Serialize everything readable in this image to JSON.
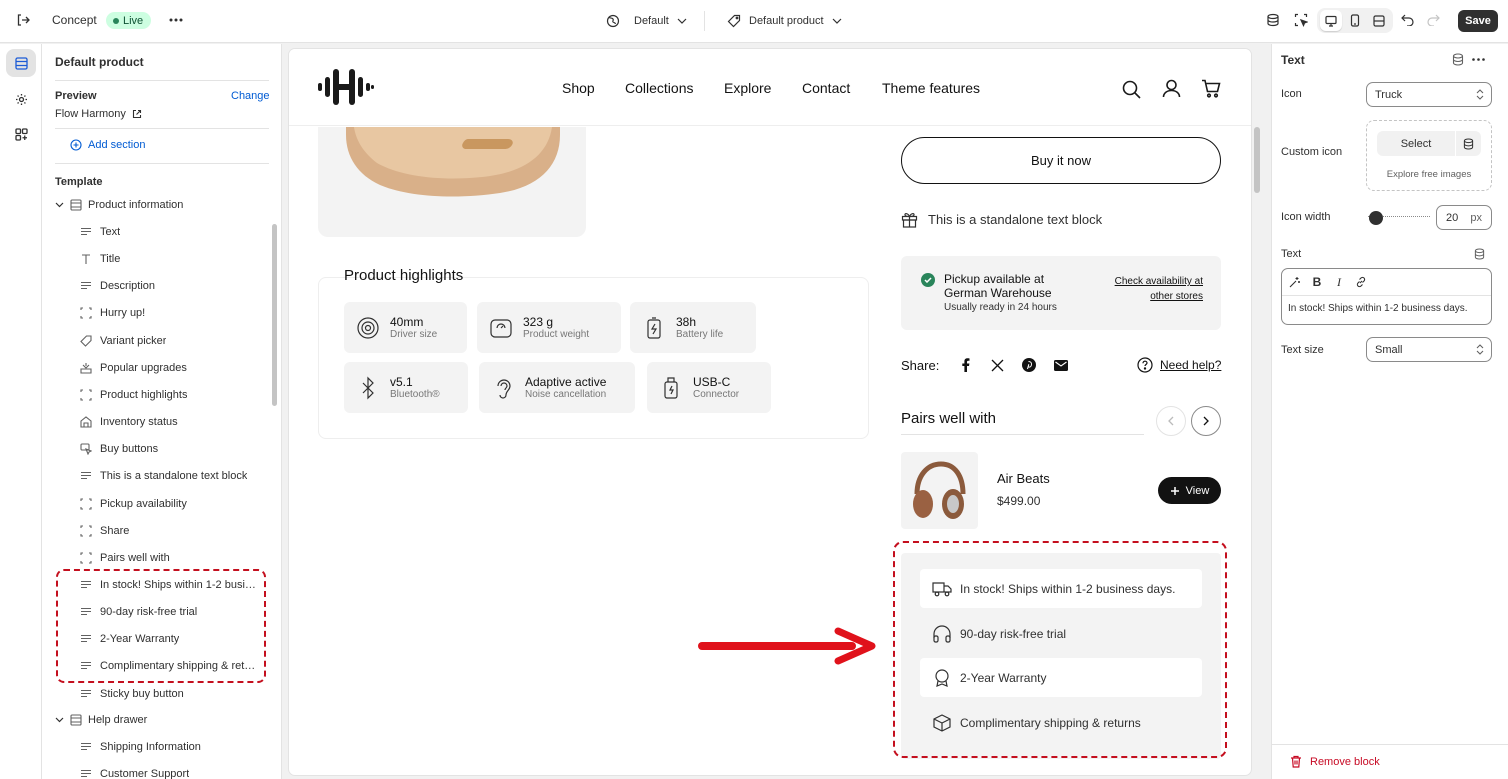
{
  "topbar": {
    "theme_name": "Concept",
    "status": "Live",
    "template_selector": "Default",
    "product_selector": "Default product",
    "save_label": "Save"
  },
  "left_panel": {
    "title": "Default product",
    "preview_label": "Preview",
    "change_label": "Change",
    "preview_product": "Flow Harmony",
    "add_section": "Add section",
    "template_label": "Template",
    "product_information": "Product information",
    "blocks": [
      "Text",
      "Title",
      "Description",
      "Hurry up!",
      "Variant picker",
      "Popular upgrades",
      "Product highlights",
      "Inventory status",
      "Buy buttons",
      "This is a standalone text block",
      "Pickup availability",
      "Share",
      "Pairs well with",
      "In stock! Ships within 1-2 business days.",
      "90-day risk-free trial",
      "2-Year Warranty",
      "Complimentary shipping & returns",
      "Sticky buy button"
    ],
    "help_drawer": "Help drawer",
    "help_items": [
      "Shipping Information",
      "Customer Support"
    ]
  },
  "store": {
    "nav": [
      "Shop",
      "Collections",
      "Explore",
      "Contact",
      "Theme features"
    ],
    "buy_now": "Buy it now",
    "standalone_text": "This is a standalone text block",
    "highlights_title": "Product highlights",
    "highlights": [
      {
        "value": "40mm",
        "label": "Driver size",
        "icon": "speaker-icon"
      },
      {
        "value": "323 g",
        "label": "Product weight",
        "icon": "scale-icon"
      },
      {
        "value": "38h",
        "label": "Battery life",
        "icon": "battery-icon"
      },
      {
        "value": "v5.1",
        "label": "Bluetooth®",
        "icon": "bluetooth-icon"
      },
      {
        "value": "Adaptive active",
        "label": "Noise cancellation",
        "icon": "ear-icon"
      },
      {
        "value": "USB-C",
        "label": "Connector",
        "icon": "usb-icon"
      }
    ],
    "pickup": {
      "title": "Pickup available at German Warehouse",
      "subtitle": "Usually ready in 24 hours",
      "link": "Check availability at other stores"
    },
    "share_label": "Share:",
    "need_help": "Need help?",
    "pairs_title": "Pairs well with",
    "pair_product": {
      "name": "Air Beats",
      "price": "$499.00",
      "button": "View"
    },
    "usps": [
      {
        "text": "In stock! Ships within 1-2 business days.",
        "icon": "truck-icon"
      },
      {
        "text": "90-day risk-free trial",
        "icon": "headphones-icon"
      },
      {
        "text": "2-Year Warranty",
        "icon": "badge-icon"
      },
      {
        "text": "Complimentary shipping & returns",
        "icon": "box-icon"
      }
    ]
  },
  "right_panel": {
    "title": "Text",
    "icon_label": "Icon",
    "icon_value": "Truck",
    "custom_icon_label": "Custom icon",
    "select_label": "Select",
    "explore_label": "Explore free images",
    "icon_width_label": "Icon width",
    "icon_width_value": "20",
    "icon_width_unit": "px",
    "icon_width_slider_fraction": 0.05,
    "text_label": "Text",
    "text_value": "In stock! Ships within 1-2 business days.",
    "text_size_label": "Text size",
    "text_size_value": "Small",
    "remove_block": "Remove block"
  },
  "colors": {
    "annotation_red": "#d72c0d",
    "live_green": "#29845a",
    "remove_red": "#c70a24"
  }
}
